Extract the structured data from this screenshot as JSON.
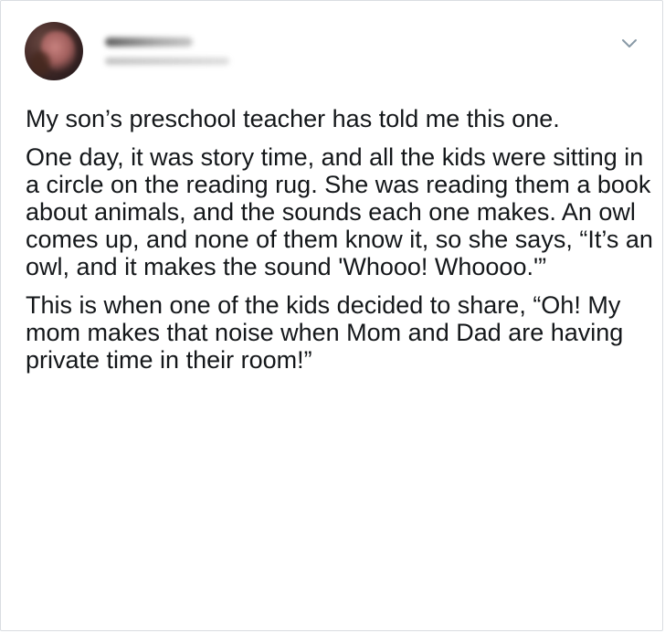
{
  "tweet": {
    "author_name": "",
    "author_handle": "",
    "paragraphs": [
      "My son’s preschool teacher has told me this one.",
      "One day, it was story time, and all the kids were sitting in a circle on the reading rug. She was reading them a book about animals, and the sounds each one makes. An owl comes up, and none of them know it, so she says, “It’s an owl, and it makes the sound 'Whooo! Whoooo.'”",
      "This is when one of the kids decided to share, “Oh! My mom makes that noise when Mom and Dad are having private time in their room!”"
    ]
  },
  "icons": {
    "menu": "chevron-down-icon"
  },
  "colors": {
    "text": "#14171a",
    "icon": "#8899a6",
    "border": "#d9dde1"
  }
}
